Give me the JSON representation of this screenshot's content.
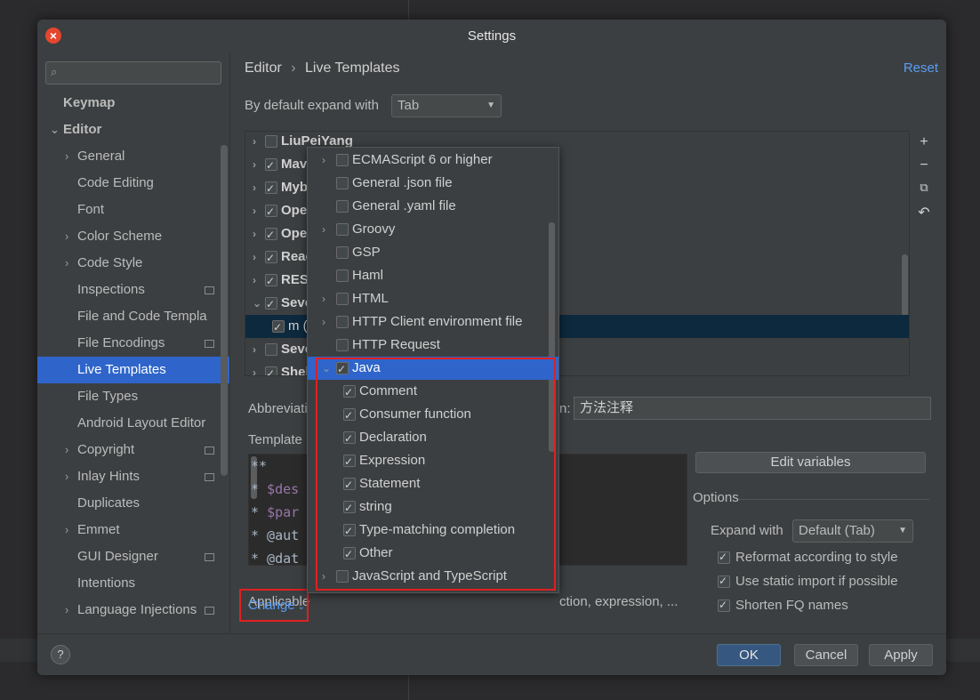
{
  "window": {
    "title": "Settings"
  },
  "sidebar": {
    "search_placeholder": "",
    "items": [
      {
        "label": "Keymap"
      },
      {
        "label": "Editor"
      },
      {
        "label": "General"
      },
      {
        "label": "Code Editing"
      },
      {
        "label": "Font"
      },
      {
        "label": "Color Scheme"
      },
      {
        "label": "Code Style"
      },
      {
        "label": "Inspections"
      },
      {
        "label": "File and Code Templa"
      },
      {
        "label": "File Encodings"
      },
      {
        "label": "Live Templates"
      },
      {
        "label": "File Types"
      },
      {
        "label": "Android Layout Editor"
      },
      {
        "label": "Copyright"
      },
      {
        "label": "Inlay Hints"
      },
      {
        "label": "Duplicates"
      },
      {
        "label": "Emmet"
      },
      {
        "label": "GUI Designer"
      },
      {
        "label": "Intentions"
      },
      {
        "label": "Language Injections"
      }
    ],
    "selected": "Live Templates"
  },
  "header": {
    "breadcrumb_parent": "Editor",
    "breadcrumb_sep": "›",
    "breadcrumb_current": "Live Templates",
    "reset_label": "Reset"
  },
  "expand": {
    "label": "By default expand with",
    "value": "Tab"
  },
  "tree": {
    "rows": [
      {
        "label": "LiuPeiYang",
        "checked": false
      },
      {
        "label": "Mave",
        "checked": true
      },
      {
        "label": "Myba",
        "checked": true
      },
      {
        "label": "Oper",
        "checked": true
      },
      {
        "label": "Oper",
        "checked": true
      },
      {
        "label": "Reac",
        "checked": true
      },
      {
        "label": "REST",
        "checked": true
      },
      {
        "label": "Seve",
        "checked": true,
        "expanded": true
      },
      {
        "label": "m (",
        "checked": true,
        "child": true
      },
      {
        "label": "Seve",
        "checked": false
      },
      {
        "label": "Shel",
        "checked": true
      }
    ],
    "toolbar": [
      "add-icon",
      "remove-icon",
      "copy-icon",
      "undo-icon"
    ]
  },
  "abbrev": {
    "label": "Abbreviati",
    "desc_label": "n:",
    "desc_value": "方法注释"
  },
  "template": {
    "label": "Template",
    "lines": [
      {
        "plain": "**",
        "var": ""
      },
      {
        "plain": " * ",
        "var": "$des"
      },
      {
        "plain": " * ",
        "var": "$par"
      },
      {
        "plain": " * @aut",
        "var": ""
      },
      {
        "plain": " * @dat",
        "var": ""
      }
    ]
  },
  "edit_variables_label": "Edit variables",
  "options": {
    "title": "Options",
    "expand_label": "Expand with",
    "expand_value": "Default (Tab)",
    "checks": [
      {
        "label": "Reformat according to style",
        "checked": true
      },
      {
        "label": "Use static import if possible",
        "checked": true
      },
      {
        "label": "Shorten FQ names",
        "checked": true
      }
    ]
  },
  "applicable": {
    "label": "Applicable",
    "tail": "ction, expression, ..."
  },
  "change_label": "Change",
  "popup": {
    "rows": [
      {
        "label": "ECMAScript 6 or higher",
        "arrow": true,
        "checked": false,
        "indent": 0
      },
      {
        "label": "General .json file",
        "arrow": false,
        "checked": false,
        "indent": 0
      },
      {
        "label": "General .yaml file",
        "arrow": false,
        "checked": false,
        "indent": 0
      },
      {
        "label": "Groovy",
        "arrow": true,
        "checked": false,
        "indent": 0
      },
      {
        "label": "GSP",
        "arrow": false,
        "checked": false,
        "indent": 0
      },
      {
        "label": "Haml",
        "arrow": false,
        "checked": false,
        "indent": 0
      },
      {
        "label": "HTML",
        "arrow": true,
        "checked": false,
        "indent": 0
      },
      {
        "label": "HTTP Client environment file",
        "arrow": true,
        "checked": false,
        "indent": 0
      },
      {
        "label": "HTTP Request",
        "arrow": false,
        "checked": false,
        "indent": 0
      },
      {
        "label": "Java",
        "arrow": true,
        "checked": true,
        "indent": 0,
        "selected": true,
        "expanded": true
      },
      {
        "label": "Comment",
        "arrow": false,
        "checked": true,
        "indent": 1
      },
      {
        "label": "Consumer function",
        "arrow": false,
        "checked": true,
        "indent": 1
      },
      {
        "label": "Declaration",
        "arrow": false,
        "checked": true,
        "indent": 1
      },
      {
        "label": "Expression",
        "arrow": false,
        "checked": true,
        "indent": 1
      },
      {
        "label": "Statement",
        "arrow": false,
        "checked": true,
        "indent": 1
      },
      {
        "label": "string",
        "arrow": false,
        "checked": true,
        "indent": 1
      },
      {
        "label": "Type-matching completion",
        "arrow": false,
        "checked": true,
        "indent": 1
      },
      {
        "label": "Other",
        "arrow": false,
        "checked": true,
        "indent": 1
      },
      {
        "label": "JavaScript and TypeScript",
        "arrow": true,
        "checked": false,
        "indent": 0
      }
    ]
  },
  "footer": {
    "help": "?",
    "ok": "OK",
    "cancel": "Cancel",
    "apply": "Apply"
  },
  "colors": {
    "accent": "#2f65ca",
    "link": "#589df6",
    "highlight_box": "#e02020",
    "bg": "#3c3f41"
  }
}
